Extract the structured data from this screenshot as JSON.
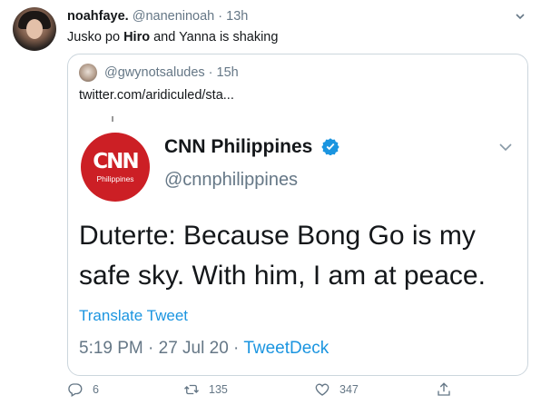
{
  "tweet": {
    "display_name": "noahfaye.",
    "handle": "@naneninoah",
    "separator": "·",
    "time": "13h",
    "text_before": "Jusko po ",
    "text_bold": "Hiro",
    "text_after": " and Yanna is shaking"
  },
  "quoted": {
    "handle": "@gwynotsaludes",
    "separator": "·",
    "time": "15h",
    "link_text": "twitter.com/aridiculed/sta..."
  },
  "screenshot": {
    "logo_text": "CNN",
    "logo_subtext": "Philippines",
    "account_name": "CNN Philippines",
    "account_handle": "@cnnphilippines",
    "line1": "Duterte: Because Bong Go is my",
    "line2": "safe sky. With him, I am at peace.",
    "translate": "Translate Tweet",
    "time_date": "5:19 PM · 27 Jul 20 · ",
    "source": "TweetDeck"
  },
  "actions": {
    "reply_count": "6",
    "retweet_count": "135",
    "like_count": "347"
  },
  "colors": {
    "link": "#1b95e0",
    "muted": "#657786",
    "cnn_red": "#cc1f25"
  },
  "icons": [
    "chevron-down-icon",
    "reply-icon",
    "retweet-icon",
    "like-icon",
    "share-icon",
    "verified-badge-icon"
  ]
}
